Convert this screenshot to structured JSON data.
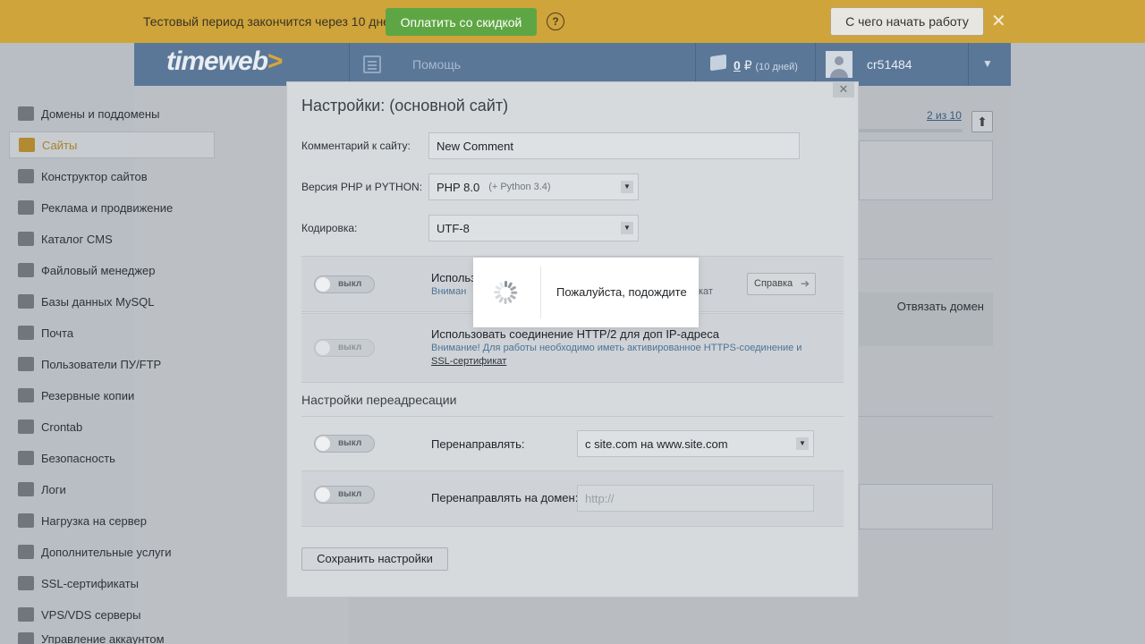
{
  "trial_bar": {
    "text": "Тестовый период закончится через 10 дней",
    "pay_button": "Оплатить со скидкой",
    "help": "?",
    "start_button": "С чего начать работу",
    "close": "✕"
  },
  "header": {
    "logo": "timeweb",
    "logo_arrow": ">",
    "help_label": "Помощь",
    "balance": "0",
    "currency": "₽",
    "balance_days": "(10 дней)",
    "username": "cr51484",
    "caret": "▼"
  },
  "sidebar": {
    "items": [
      {
        "label": "Домены и поддомены",
        "icon": "sitemap-icon"
      },
      {
        "label": "Сайты",
        "icon": "sites-icon"
      },
      {
        "label": "Конструктор сайтов",
        "icon": "builder-icon"
      },
      {
        "label": "Реклама и продвижение",
        "icon": "chart-icon"
      },
      {
        "label": "Каталог CMS",
        "icon": "briefcase-icon"
      },
      {
        "label": "Файловый менеджер",
        "icon": "folder-icon"
      },
      {
        "label": "Базы данных MySQL",
        "icon": "database-icon"
      },
      {
        "label": "Почта",
        "icon": "mailbox-icon"
      },
      {
        "label": "Пользователи ПУ/FTP",
        "icon": "users-icon"
      },
      {
        "label": "Резервные копии",
        "icon": "backup-icon"
      },
      {
        "label": "Crontab",
        "icon": "clock-file-icon"
      },
      {
        "label": "Безопасность",
        "icon": "shield-icon"
      },
      {
        "label": "Логи",
        "icon": "log-icon"
      },
      {
        "label": "Нагрузка на сервер",
        "icon": "bars-icon"
      },
      {
        "label": "Дополнительные услуги",
        "icon": "badge-icon"
      },
      {
        "label": "SSL-сертификаты",
        "icon": "certificate-icon"
      },
      {
        "label": "VPS/VDS серверы",
        "icon": "server-icon"
      },
      {
        "label": "Управление аккаунтом",
        "icon": "account-icon"
      }
    ]
  },
  "background": {
    "pager": "2 из 10",
    "up": "⬆",
    "unbind_domain": "Отвязать домен"
  },
  "modal": {
    "close": "✕",
    "title": "Настройки: (основной сайт)",
    "comment_label": "Комментарий к сайту:",
    "comment_value": "New Comment",
    "php_label": "Версия PHP и PYTHON:",
    "php_value": "PHP 8.0",
    "php_hint": "(+ Python 3.4)",
    "encoding_label": "Кодировка:",
    "encoding_value": "UTF-8",
    "select_arrow": "▼",
    "option1_title": "Использ",
    "option1_warn": "Вниман",
    "option1_tail": "кат",
    "help_button": "Справка",
    "help_arrow": "➔",
    "option2_title": "Использовать соединение HTTP/2 для доп IP-адреса",
    "option2_warn": "Внимание! Для работы необходимо иметь активированное HTTPS-соединение и",
    "option2_link": "SSL-сертификат",
    "toggle_off": "выкл",
    "redirect_section": "Настройки переадресации",
    "redirect_label": "Перенаправлять:",
    "redirect_value": "с site.com на www.site.com",
    "redirect_domain_label": "Перенаправлять на домен:",
    "redirect_domain_placeholder": "http://",
    "save_button": "Сохранить настройки"
  },
  "loader": {
    "text": "Пожалуйста, подождите"
  }
}
